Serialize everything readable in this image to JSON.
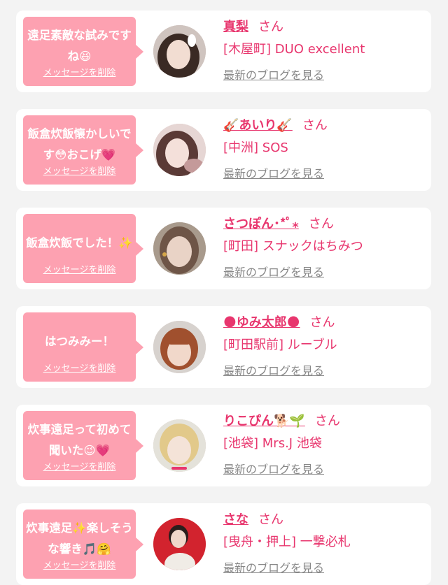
{
  "cards": [
    {
      "message": "遠足素敵な試みですね😆",
      "delete_label": "メッセージを削除",
      "name": "真梨",
      "honorific": "さん",
      "shop": "[木屋町] DUO excellent",
      "blog_link": "最新のブログを見る",
      "avatar": {
        "bg": "#cfc4bf",
        "face": "#f2ddd2",
        "hair": "#3a2a24",
        "accent": "#ffffff"
      }
    },
    {
      "message": "飯盒炊飯懐かしいです😳おこげ💗",
      "delete_label": "メッセージを削除",
      "name": "🎸あいり🎸",
      "honorific": "さん",
      "shop": "[中洲] SOS",
      "blog_link": "最新のブログを見る",
      "avatar": {
        "bg": "#e6d6d4",
        "face": "#f4e0da",
        "hair": "#5a3a36",
        "accent": "#c49a9a"
      }
    },
    {
      "message": "飯盒炊飯でした！✨",
      "delete_label": "メッセージを削除",
      "name": "さつぽん･*ﾟ⁎",
      "honorific": "さん",
      "shop": "[町田] スナックはちみつ",
      "blog_link": "最新のブログを見る",
      "avatar": {
        "bg": "#a89a8c",
        "face": "#e9d3c6",
        "hair": "#6e5547",
        "accent": "#d4a64a"
      }
    },
    {
      "message": "はつみみー！",
      "delete_label": "メッセージを削除",
      "name": "🌑ゆみ太郎🌑",
      "honorific": "さん",
      "shop": "[町田駅前] ルーブル",
      "blog_link": "最新のブログを見る",
      "avatar": {
        "bg": "#d7d2ce",
        "face": "#f1d8ca",
        "hair": "#a0502e",
        "accent": "#a0502e"
      }
    },
    {
      "message": "炊事遠足って初めて聞いた😉💗",
      "delete_label": "メッセージを削除",
      "name": "りこぴん🐕🌱",
      "honorific": "さん",
      "shop": "[池袋] Mrs.J 池袋",
      "blog_link": "最新のブログを見る",
      "avatar": {
        "bg": "#e4e2da",
        "face": "#f4e3d8",
        "hair": "#e2c98a",
        "accent": "#e8366e"
      }
    },
    {
      "message": "炊事遠足✨楽しそうな響き🎵🤗",
      "delete_label": "メッセージを削除",
      "name": "さな",
      "honorific": "さん",
      "shop": "[曳舟・押上] 一撃必札",
      "blog_link": "最新のブログを見る",
      "avatar": {
        "bg": "#d2232e",
        "face": "#f0d7ca",
        "hair": "#2a1e1c",
        "accent": "#f0ece6"
      }
    }
  ]
}
